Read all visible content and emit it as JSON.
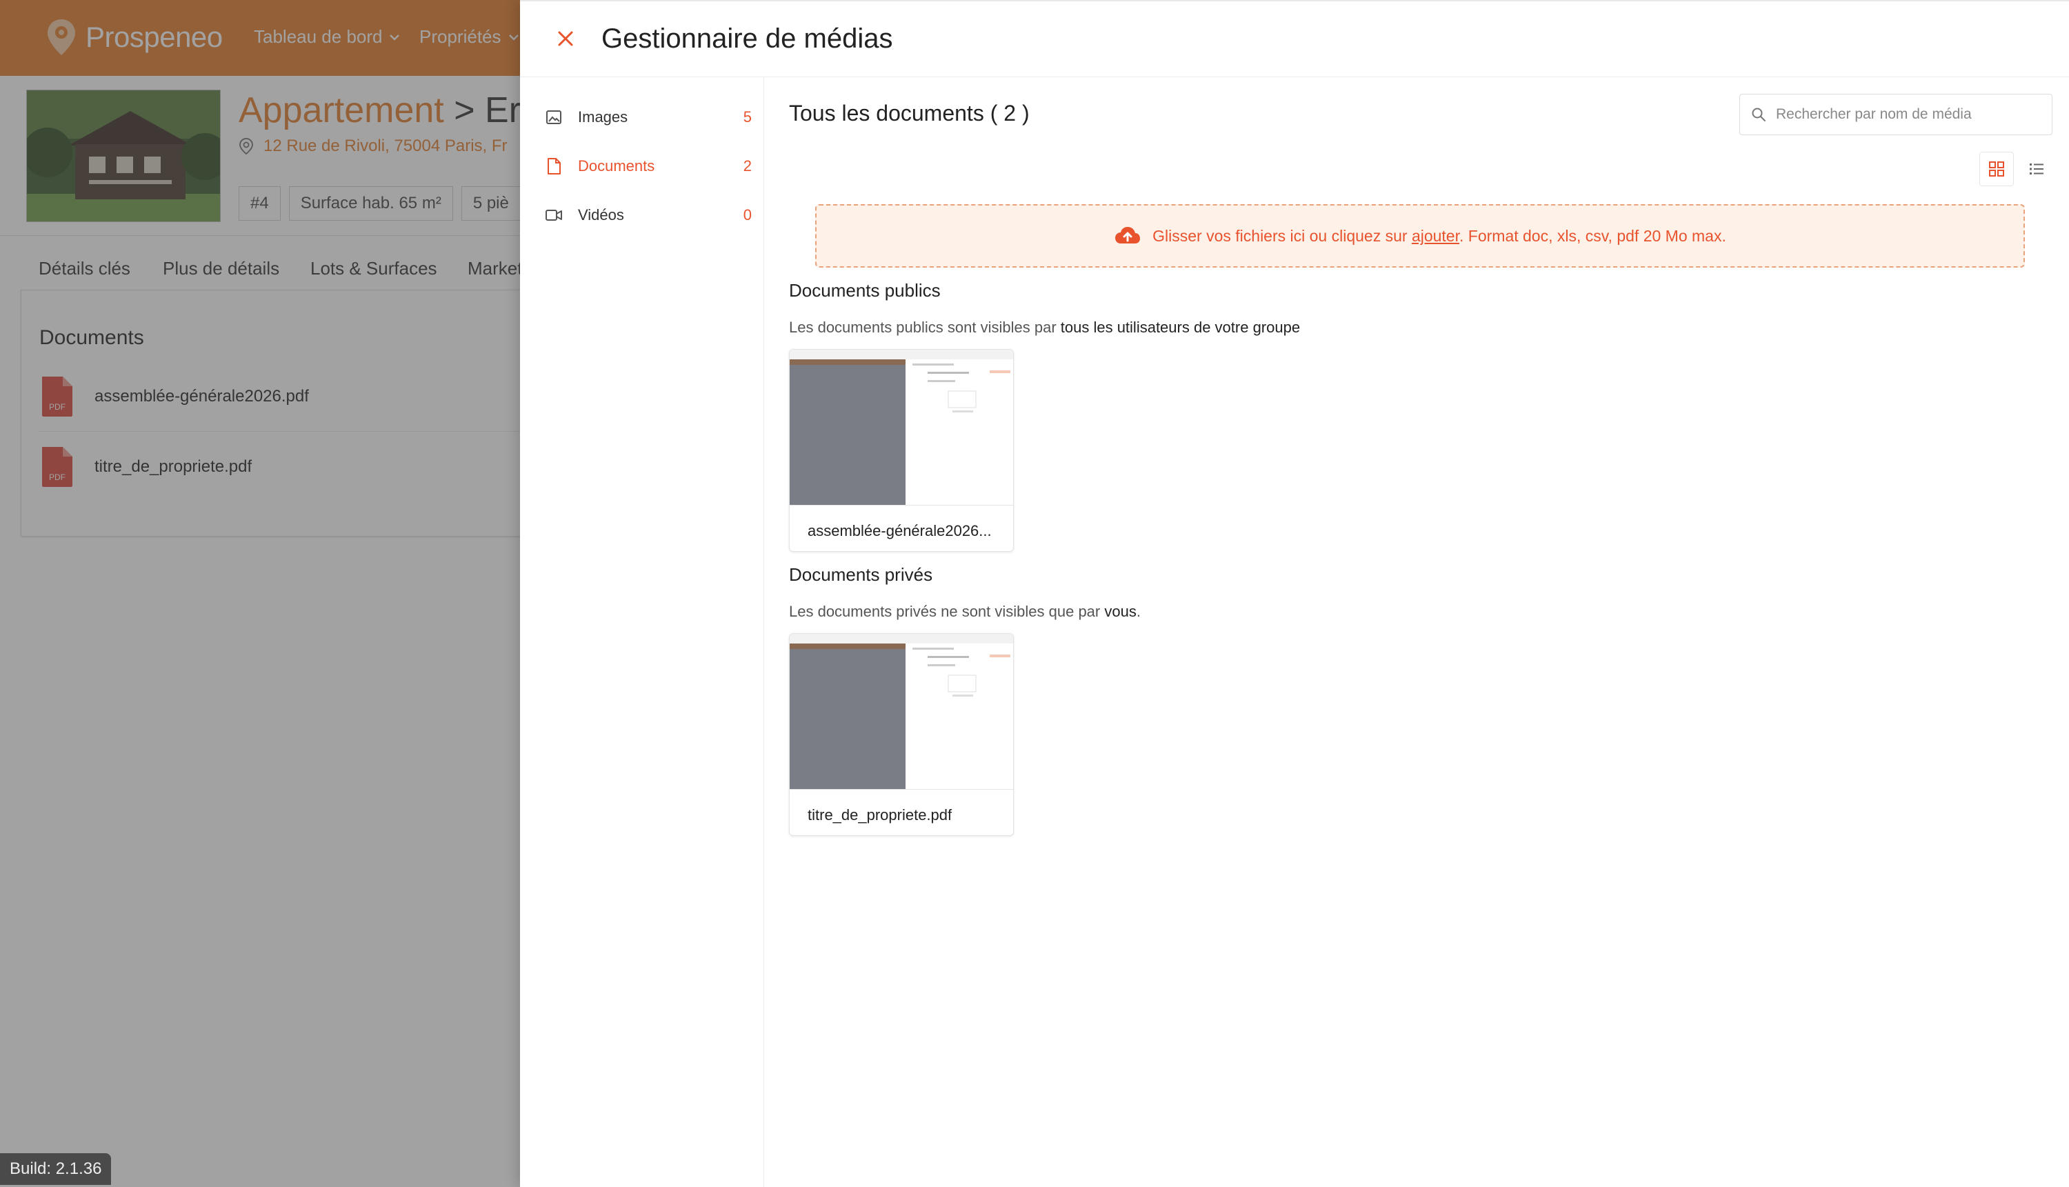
{
  "app": {
    "logo_text": "Prospeneo",
    "nav": [
      "Tableau de bord",
      "Propriétés"
    ],
    "build": "Build: 2.1.36"
  },
  "property": {
    "type": "Appartement",
    "separator": ">",
    "name_partial": "Er",
    "address": "12 Rue de Rivoli, 75004 Paris, Fr",
    "chips": [
      "#4",
      "Surface hab. 65 m²",
      "5 piè"
    ]
  },
  "tabs": [
    "Détails clés",
    "Plus de détails",
    "Lots & Surfaces",
    "Market"
  ],
  "documents_card": {
    "title": "Documents",
    "items": [
      "assemblée-générale2026.pdf",
      "titre_de_propriete.pdf"
    ],
    "file_type": "PDF"
  },
  "drawer": {
    "title": "Gestionnaire de médias",
    "sidebar": [
      {
        "label": "Images",
        "count": "5"
      },
      {
        "label": "Documents",
        "count": "2"
      },
      {
        "label": "Vidéos",
        "count": "0"
      }
    ],
    "content_title": "Tous les documents ( 2 )",
    "search_placeholder": "Rechercher par nom de média",
    "dropzone": {
      "text_before": "Glisser vos fichiers ici ou cliquez sur ",
      "link": "ajouter",
      "text_after": ". Format doc, xls, csv, pdf 20 Mo max."
    },
    "public": {
      "title": "Documents publics",
      "desc_before": "Les documents publics sont visibles par ",
      "desc_bold": "tous les utilisateurs de votre groupe",
      "files": [
        "assemblée-générale2026..."
      ]
    },
    "private": {
      "title": "Documents privés",
      "desc_before": "Les documents privés ne sont visibles que par ",
      "desc_bold": "vous",
      "desc_after": ".",
      "files": [
        "titre_de_propriete.pdf"
      ]
    }
  },
  "colors": {
    "brand": "#e07a2a",
    "accent": "#e8532e",
    "dropzone_bg": "#fdf1e8"
  }
}
